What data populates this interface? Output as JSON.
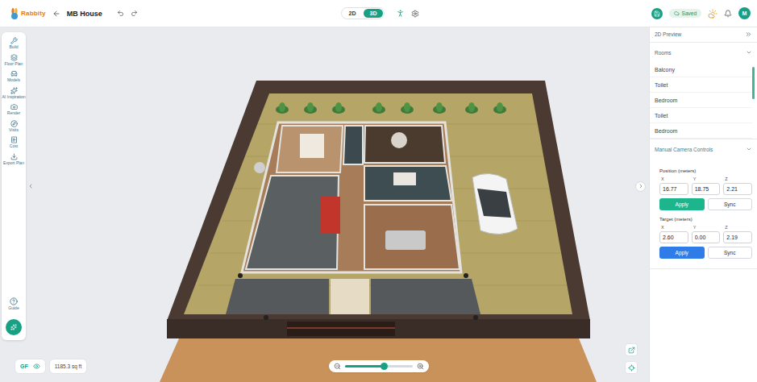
{
  "header": {
    "logo": "Rabbity",
    "project": "MB House",
    "view_modes": [
      {
        "label": "2D",
        "selected": false
      },
      {
        "label": "3D",
        "selected": true
      }
    ],
    "save_status": "Saved",
    "avatar": "M"
  },
  "sidebar": {
    "items": [
      {
        "label": "Build"
      },
      {
        "label": "Floor Plan"
      },
      {
        "label": "Models"
      },
      {
        "label": "AI Inspiration"
      },
      {
        "label": "Render"
      },
      {
        "label": "Visits"
      },
      {
        "label": "Cost"
      },
      {
        "label": "Export Plan"
      }
    ],
    "help": "Guide"
  },
  "floor": {
    "label": "GF",
    "visible": true,
    "area": "1185.3 sq ft"
  },
  "zoom": {
    "level": 0.57
  },
  "panel": {
    "preview": {
      "title": "2D Preview"
    },
    "rooms": {
      "title": "Rooms",
      "expanded": true,
      "items": [
        "Balcony",
        "Toilet",
        "Bedroom",
        "Toilet",
        "Bedroom"
      ]
    },
    "camera": {
      "title": "Manual Camera Controls",
      "expanded": true,
      "groups": [
        {
          "title": "Position (meters)",
          "fields": [
            {
              "axis": "X",
              "value": "16.77"
            },
            {
              "axis": "Y",
              "value": "18.75"
            },
            {
              "axis": "Z",
              "value": "2.21"
            }
          ],
          "apply": "Apply",
          "sync": "Sync",
          "color": "#1db58c"
        },
        {
          "title": "Target (meters)",
          "fields": [
            {
              "axis": "X",
              "value": "2.60"
            },
            {
              "axis": "Y",
              "value": "0.00"
            },
            {
              "axis": "Z",
              "value": "2.19"
            }
          ],
          "apply": "Apply",
          "sync": "Sync",
          "color": "#2f7be8"
        }
      ]
    }
  }
}
